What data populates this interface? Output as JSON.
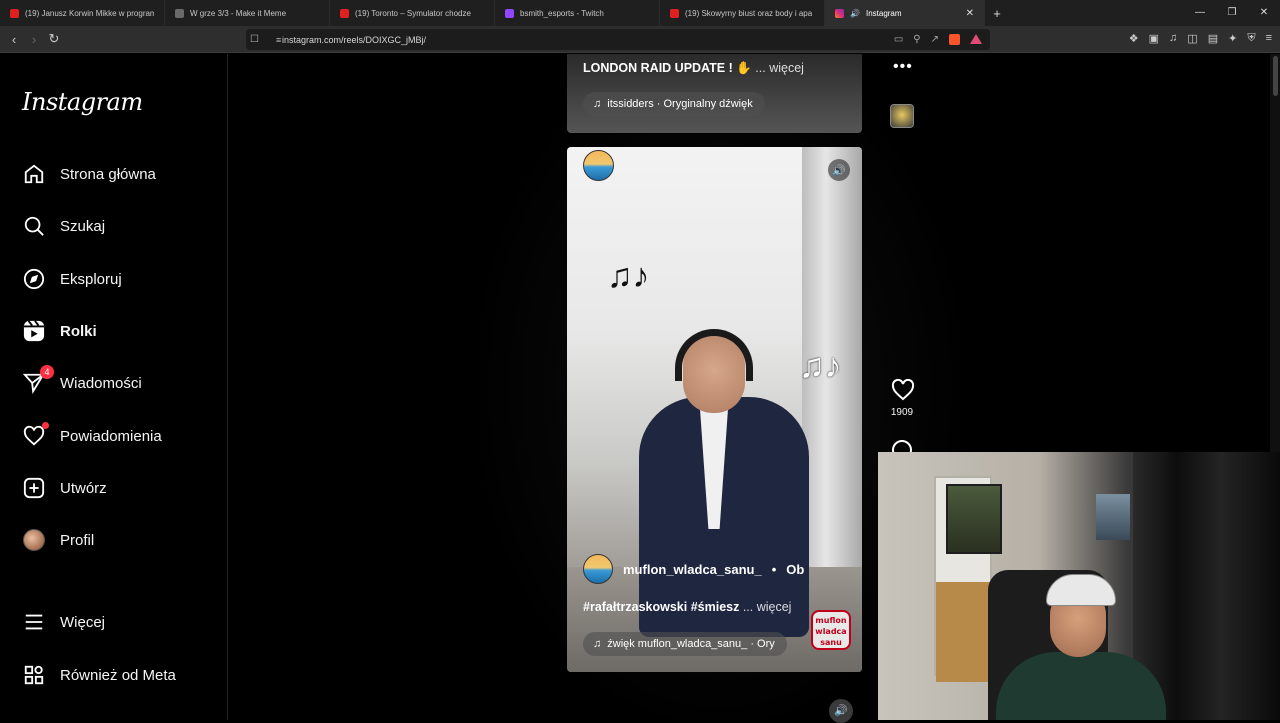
{
  "browser": {
    "tabs": [
      {
        "label": "(19) Janusz Korwin Mikke w program",
        "icon": "youtube-icon"
      },
      {
        "label": "W grze 3/3 - Make it Meme",
        "icon": "mim-icon"
      },
      {
        "label": "(19) Toronto – Symulator chodze",
        "icon": "youtube-icon"
      },
      {
        "label": "bsmith_esports - Twitch",
        "icon": "twitch-icon"
      },
      {
        "label": "(19) Skowyrny biust oraz body i apa",
        "icon": "youtube-icon"
      },
      {
        "label": "Instagram",
        "icon": "instagram-icon"
      }
    ],
    "new_tab": "+",
    "url": "instagram.com/reels/DOIXGC_jMBj/"
  },
  "sidebar": {
    "logo": "Instagram",
    "items": [
      {
        "label": "Strona główna",
        "icon": "home-icon"
      },
      {
        "label": "Szukaj",
        "icon": "search-icon"
      },
      {
        "label": "Eksploruj",
        "icon": "compass-icon"
      },
      {
        "label": "Rolki",
        "icon": "reels-icon"
      },
      {
        "label": "Wiadomości",
        "icon": "messenger-icon",
        "badge": "4"
      },
      {
        "label": "Powiadomienia",
        "icon": "heart-icon"
      },
      {
        "label": "Utwórz",
        "icon": "plus-square-icon"
      },
      {
        "label": "Profil",
        "icon": "avatar"
      },
      {
        "label": "Więcej",
        "icon": "hamburger-icon"
      },
      {
        "label": "Również od Meta",
        "icon": "meta-grid-icon"
      }
    ]
  },
  "prev_reel": {
    "caption": "LONDON RAID UPDATE ! ✋",
    "more": "... więcej",
    "audio": "itssidders · Oryginalny dźwięk"
  },
  "reel": {
    "username": "muflon_wladca_sanu_",
    "separator": "•",
    "follow_label": "Ob",
    "caption": "#rafałtrzaskowski #śmiesz",
    "more": "... więcej",
    "audio": "źwięk   muflon_wladca_sanu_ · Ory",
    "sticker": "muflon wladca sanu"
  },
  "actions": {
    "more": "•••",
    "likes": "1909"
  },
  "colors": {
    "accent_badge": "#ff3040",
    "background": "#000000"
  }
}
